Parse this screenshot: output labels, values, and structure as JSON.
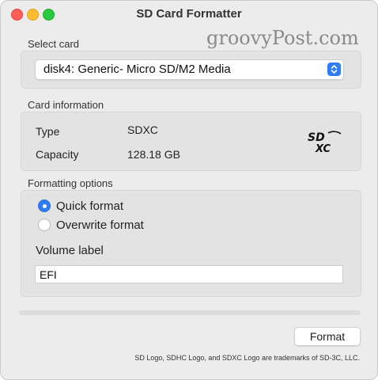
{
  "window": {
    "title": "SD Card Formatter",
    "watermark": "groovyPost.com"
  },
  "select_card": {
    "section_label": "Select card",
    "selected": "disk4: Generic- Micro SD/M2 Media"
  },
  "card_info": {
    "section_label": "Card information",
    "type_label": "Type",
    "type_value": "SDXC",
    "capacity_label": "Capacity",
    "capacity_value": "128.18 GB",
    "logo_text": "SDXC"
  },
  "formatting": {
    "section_label": "Formatting options",
    "options": [
      {
        "label": "Quick format",
        "selected": true
      },
      {
        "label": "Overwrite format",
        "selected": false
      }
    ],
    "volume_label_title": "Volume label",
    "volume_label_value": "EFI"
  },
  "progress": {
    "value": 0
  },
  "actions": {
    "format_label": "Format"
  },
  "footer": {
    "trademark": "SD Logo, SDHC Logo, and SDXC Logo are trademarks of SD-3C, LLC."
  },
  "colors": {
    "accent": "#2f7cf6",
    "close": "#ff5f57",
    "minimize": "#febc2e",
    "zoom": "#28c840"
  }
}
